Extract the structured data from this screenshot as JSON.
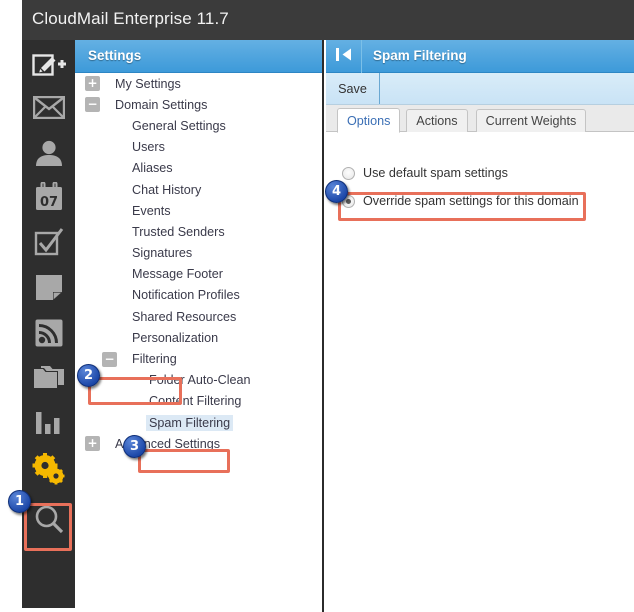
{
  "app": {
    "title": "CloudMail Enterprise 11.7"
  },
  "iconrail": {
    "items": [
      {
        "name": "compose-new-icon",
        "label": "Compose New"
      },
      {
        "name": "mail-icon",
        "label": "Mail"
      },
      {
        "name": "contacts-icon",
        "label": "Contacts"
      },
      {
        "name": "calendar-icon",
        "label": "Calendar",
        "day": "07"
      },
      {
        "name": "tasks-icon",
        "label": "Tasks"
      },
      {
        "name": "notes-icon",
        "label": "Notes"
      },
      {
        "name": "rss-feeds-icon",
        "label": "RSS Feeds"
      },
      {
        "name": "folders-icon",
        "label": "Folders"
      },
      {
        "name": "reports-icon",
        "label": "Reports"
      },
      {
        "name": "settings-gear-icon",
        "label": "Settings"
      },
      {
        "name": "search-icon",
        "label": "Search"
      }
    ]
  },
  "settings": {
    "header_title": "Settings",
    "tree": [
      {
        "label": "My Settings",
        "indent": 0,
        "toggle": "+",
        "selected": false
      },
      {
        "label": "Domain Settings",
        "indent": 0,
        "toggle": "-",
        "selected": false
      },
      {
        "label": "General Settings",
        "indent": 1,
        "toggle": "",
        "selected": false
      },
      {
        "label": "Users",
        "indent": 1,
        "toggle": "",
        "selected": false
      },
      {
        "label": "Aliases",
        "indent": 1,
        "toggle": "",
        "selected": false
      },
      {
        "label": "Chat History",
        "indent": 1,
        "toggle": "",
        "selected": false
      },
      {
        "label": "Events",
        "indent": 1,
        "toggle": "",
        "selected": false
      },
      {
        "label": "Trusted Senders",
        "indent": 1,
        "toggle": "",
        "selected": false
      },
      {
        "label": "Signatures",
        "indent": 1,
        "toggle": "",
        "selected": false
      },
      {
        "label": "Message Footer",
        "indent": 1,
        "toggle": "",
        "selected": false
      },
      {
        "label": "Notification Profiles",
        "indent": 1,
        "toggle": "",
        "selected": false
      },
      {
        "label": "Shared Resources",
        "indent": 1,
        "toggle": "",
        "selected": false
      },
      {
        "label": "Personalization",
        "indent": 1,
        "toggle": "",
        "selected": false
      },
      {
        "label": "Filtering",
        "indent": 1,
        "toggle": "-",
        "selected": false
      },
      {
        "label": "Folder Auto-Clean",
        "indent": 2,
        "toggle": "",
        "selected": false
      },
      {
        "label": "Content Filtering",
        "indent": 2,
        "toggle": "",
        "selected": false
      },
      {
        "label": "Spam Filtering",
        "indent": 2,
        "toggle": "",
        "selected": true
      },
      {
        "label": "Advanced Settings",
        "indent": 0,
        "toggle": "+",
        "selected": false
      }
    ]
  },
  "content": {
    "header_title": "Spam Filtering",
    "collapse_icon": "collapse-panel-icon",
    "toolbar": {
      "save_label": "Save"
    },
    "tabs": [
      {
        "label": "Options",
        "active": true
      },
      {
        "label": "Actions",
        "active": false
      },
      {
        "label": "Current Weights",
        "active": false
      }
    ],
    "options": {
      "radios": [
        {
          "label": "Use default spam settings",
          "checked": false
        },
        {
          "label": "Override spam settings for this domain",
          "checked": true
        }
      ]
    }
  },
  "annotations": {
    "badges": [
      {
        "num": "1",
        "target": "settings-gear-icon"
      },
      {
        "num": "2",
        "target": "tree-item-filtering"
      },
      {
        "num": "3",
        "target": "tree-item-spam-filtering"
      },
      {
        "num": "4",
        "target": "override-spam-settings-radio"
      }
    ],
    "highlight_color": "#e8705a"
  }
}
